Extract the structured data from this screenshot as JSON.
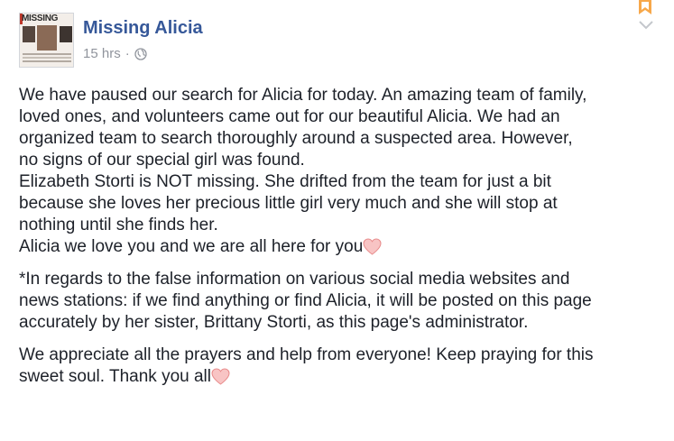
{
  "post": {
    "page_name": "Missing Alicia",
    "timestamp": "15 hrs",
    "separator": "·",
    "avatar": {
      "poster_text": "MISSING"
    },
    "icons": {
      "privacy": "globe-icon",
      "bookmark": "bookmark-icon",
      "menu": "chevron-down-icon",
      "emoji": "heart-icon"
    },
    "paragraphs": [
      {
        "lines": [
          "We have paused our search for Alicia for today. An amazing team of family,",
          "loved ones, and volunteers came out for our beautiful Alicia. We had an",
          "organized team to search thoroughly around a suspected area. However,",
          "no signs of our special girl was found.",
          "Elizabeth Storti is NOT missing. She drifted from the team for just a bit",
          "because she loves her precious little girl very much and she will stop at",
          "nothing until she finds her.",
          "Alicia we love you and we are all here for you"
        ]
      },
      {
        "lines": [
          "*In regards to the false information on various social media websites and",
          "news stations: if we find anything or find Alicia, it will be posted on this page",
          "accurately by her sister, Brittany Storti, as this page's administrator."
        ]
      },
      {
        "lines": [
          "We appreciate all the prayers and help from everyone! Keep praying for this",
          "sweet soul. Thank you all"
        ]
      }
    ]
  },
  "colors": {
    "link_blue": "#365899",
    "meta_gray": "#90949c",
    "text": "#1d2129",
    "bookmark_orange": "#f7a84a",
    "heart_pink": "#f4a6a6"
  }
}
